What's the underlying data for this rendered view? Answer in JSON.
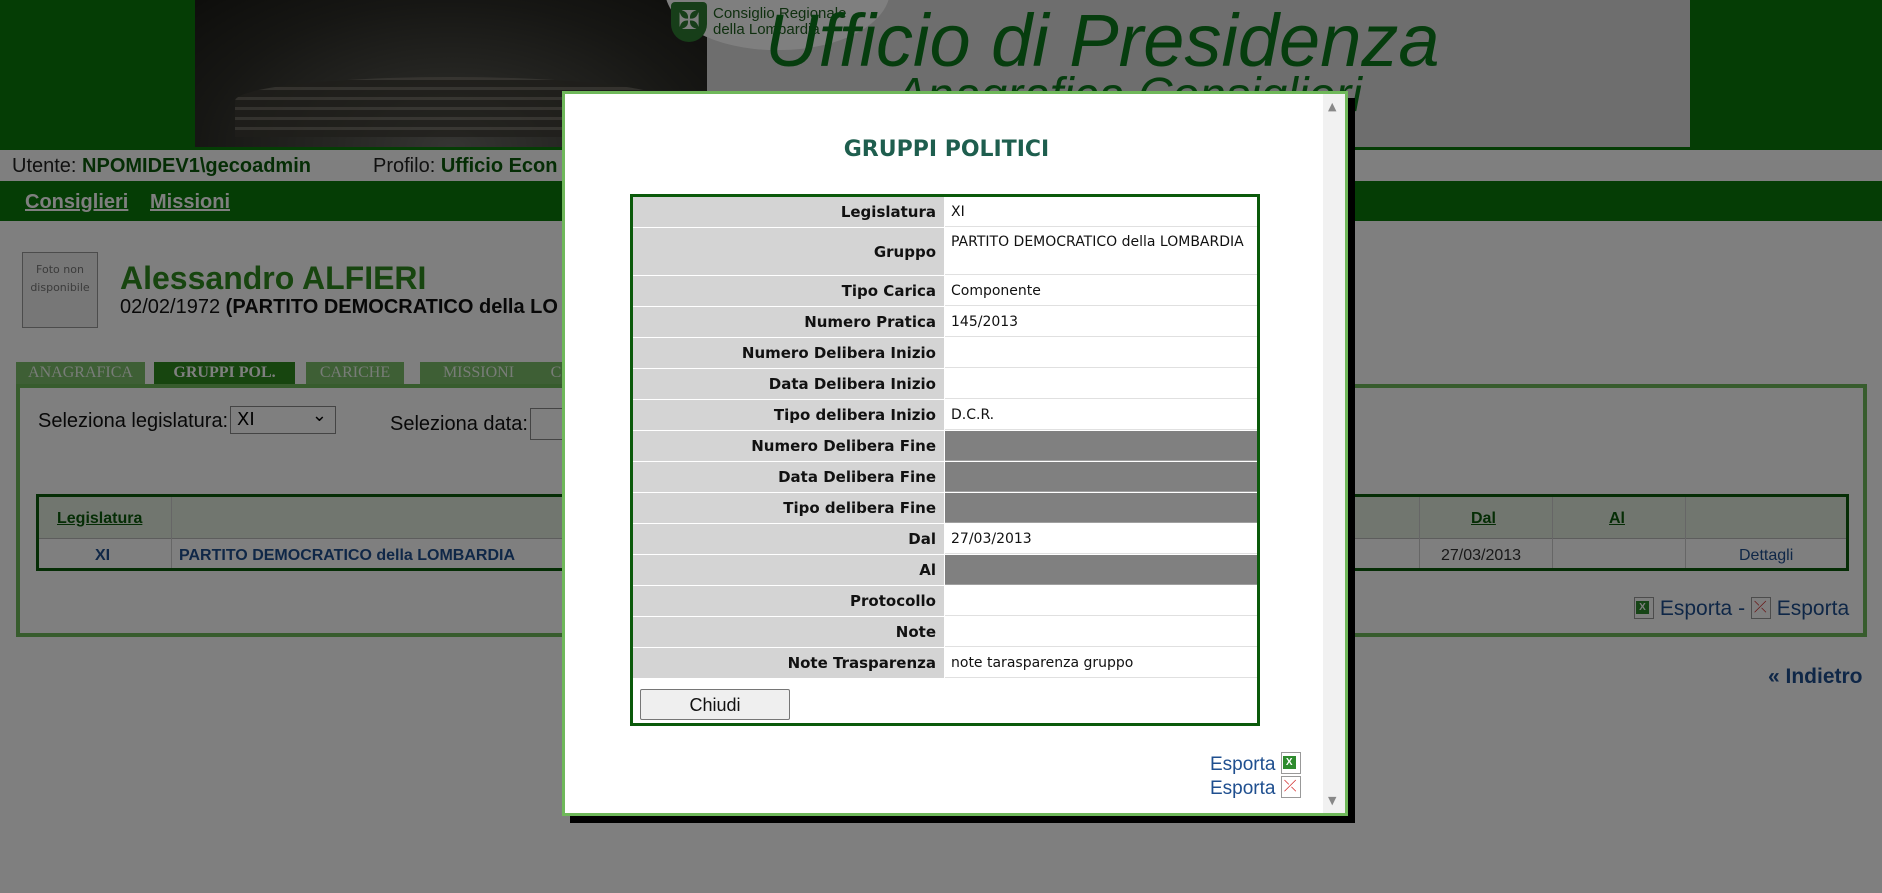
{
  "banner": {
    "logo_line1": "Consiglio Regionale",
    "logo_line2": "della Lombardia",
    "title": "Ufficio di Presidenza",
    "subtitle": "Anagrafica Consiglieri"
  },
  "userbar": {
    "user_label": "Utente:",
    "user_value": "NPOMIDEV1\\gecoadmin",
    "profile_label": "Profilo:",
    "profile_value": "Ufficio Econ"
  },
  "menu": {
    "item1": "Consiglieri",
    "item2": "Missioni"
  },
  "person": {
    "photo_text": "Foto non disponibile",
    "name": "Alessandro ALFIERI",
    "birth": "02/02/1972",
    "group_prefix": "(PARTITO DEMOCRATICO della LO"
  },
  "tabs": [
    "ANAGRAFICA",
    "GRUPPI POL.",
    "CARICHE",
    "MISSIONI",
    "C"
  ],
  "filters": {
    "legislatura_label": "Seleziona legislatura:",
    "legislatura_value": "XI",
    "data_label": "Seleziona data:"
  },
  "grid": {
    "headers": {
      "legislatura": "Legislatura",
      "dal": "Dal",
      "al": "Al"
    },
    "row": {
      "legislatura": "XI",
      "gruppo": "PARTITO DEMOCRATICO della LOMBARDIA",
      "dal": "27/03/2013",
      "al": "",
      "action": "Dettagli"
    }
  },
  "exports": {
    "label": "Esporta",
    "separator": "-"
  },
  "back": "« Indietro",
  "modal": {
    "title": "GRUPPI POLITICI",
    "fields": [
      {
        "label": "Legislatura",
        "value": "XI"
      },
      {
        "label": "Gruppo",
        "value": "PARTITO DEMOCRATICO della LOMBARDIA"
      },
      {
        "label": "Tipo Carica",
        "value": "Componente"
      },
      {
        "label": "Numero Pratica",
        "value": "145/2013"
      },
      {
        "label": "Numero Delibera Inizio",
        "value": ""
      },
      {
        "label": "Data Delibera Inizio",
        "value": ""
      },
      {
        "label": "Tipo delibera Inizio",
        "value": "D.C.R."
      },
      {
        "label": "Numero Delibera Fine",
        "value": ""
      },
      {
        "label": "Data Delibera Fine",
        "value": ""
      },
      {
        "label": "Tipo delibera Fine",
        "value": ""
      },
      {
        "label": "Dal",
        "value": "27/03/2013"
      },
      {
        "label": "Al",
        "value": ""
      },
      {
        "label": "Protocollo",
        "value": ""
      },
      {
        "label": "Note",
        "value": ""
      },
      {
        "label": "Note Trasparenza",
        "value": "note tarasparenza gruppo"
      }
    ],
    "close_label": "Chiudi",
    "export_excel": "Esporta",
    "export_pdf": "Esporta"
  },
  "colors": {
    "brand_green": "#0a7a0a",
    "accent_green": "#2e8b1e",
    "link_blue": "#1f4f8f",
    "label_grey": "#d4d4d4",
    "empty_dark": "#808080"
  }
}
